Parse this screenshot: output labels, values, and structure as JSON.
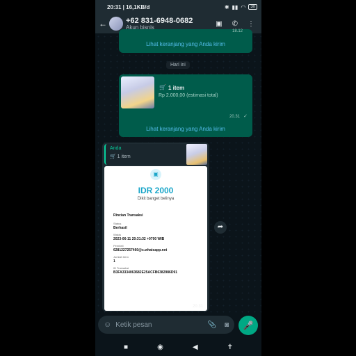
{
  "status": {
    "time_speed": "20:31 | 16,1KB/d",
    "battery": "30"
  },
  "header": {
    "title": "+62 831-6948-0682",
    "subtitle": "Akun bisnis"
  },
  "chat": {
    "top_link": "Lihat keranjang yang Anda kirim",
    "top_time": "18.12",
    "date_chip": "Hari ini",
    "cart_message": {
      "items": "1 item",
      "price": "Rp 2.000,00 (estimasi total)",
      "time": "20.31",
      "link": "Lihat keranjang yang Anda kirim"
    },
    "incoming": {
      "reply_sender": "Anda",
      "reply_items": "1 item",
      "receipt": {
        "amount": "IDR 2000",
        "note": "Dikit banget belinya",
        "heading": "Rincian Transaksi",
        "status_label": "Status",
        "status_value": "Berhasil",
        "time_label": "Waktu",
        "time_value": "2023-06-11 20:31:32 +0700 WIB",
        "buyer_label": "Pembeli",
        "buyer_value": "6281227257460@s.whatsapp.net",
        "count_label": "Jumlah Item",
        "count_value": "1",
        "id_label": "ID Transaksi",
        "id_value": "B3FA3334063682E25ACFB6382986D91"
      },
      "time": "20.31"
    }
  },
  "composer": {
    "placeholder": "Ketik pesan"
  }
}
